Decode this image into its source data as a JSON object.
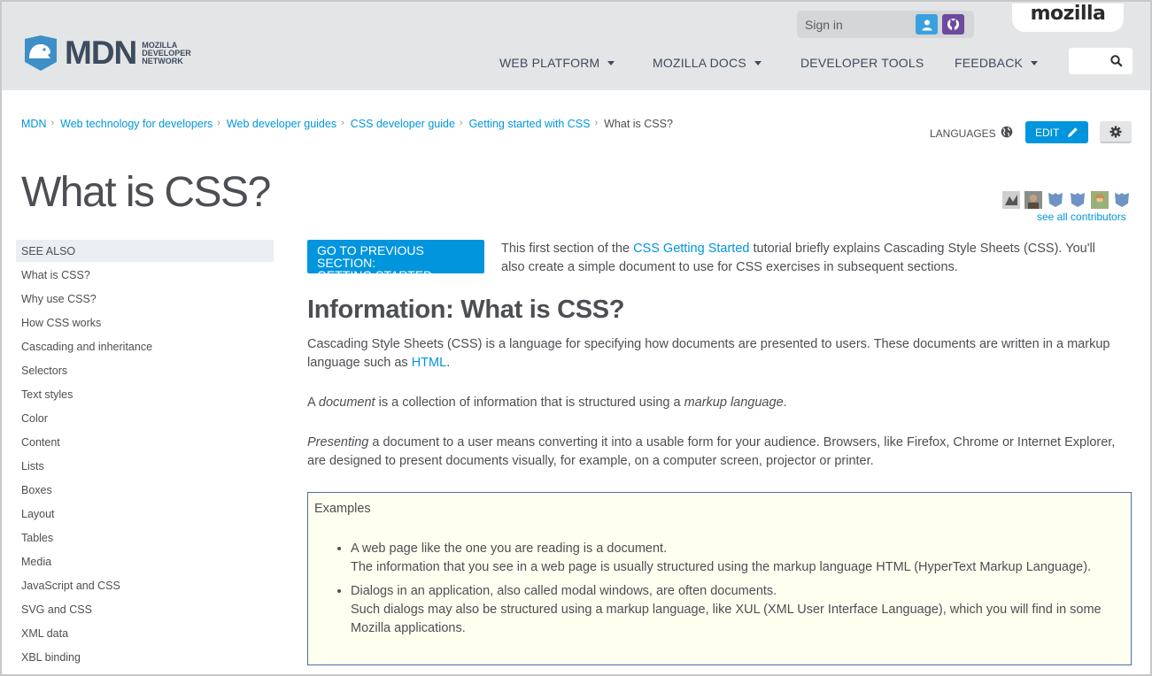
{
  "header": {
    "logo_text": "MDN",
    "logo_sub_lines": [
      "Mozilla",
      "Developer",
      "Network"
    ],
    "signin_label": "Sign in",
    "mozilla_label": "mozilla",
    "nav": [
      {
        "label": "WEB PLATFORM",
        "has_caret": true
      },
      {
        "label": "MOZILLA DOCS",
        "has_caret": true
      },
      {
        "label": "DEVELOPER TOOLS",
        "has_caret": false
      },
      {
        "label": "FEEDBACK",
        "has_caret": true
      }
    ],
    "search_icon": "search-icon"
  },
  "breadcrumbs": {
    "items": [
      "MDN",
      "Web technology for developers",
      "Web developer guides",
      "CSS developer guide",
      "Getting started with CSS"
    ],
    "current": "What is CSS?"
  },
  "toolbar": {
    "languages_label": "LANGUAGES",
    "edit_label": "EDIT"
  },
  "page": {
    "title": "What is CSS?",
    "see_all_contributors": "see all contributors"
  },
  "sidebar": {
    "heading": "SEE ALSO",
    "items": [
      "What is CSS?",
      "Why use CSS?",
      "How CSS works",
      "Cascading and inheritance",
      "Selectors",
      "Text styles",
      "Color",
      "Content",
      "Lists",
      "Boxes",
      "Layout",
      "Tables",
      "Media",
      "JavaScript and CSS",
      "SVG and CSS",
      "XML data",
      "XBL binding"
    ]
  },
  "content": {
    "prev_button_line1": "GO TO PREVIOUS SECTION:",
    "prev_button_line2": "GETTING STARTED",
    "intro_before": "This first section of the ",
    "intro_link": "CSS Getting Started",
    "intro_after": " tutorial briefly explains Cascading Style Sheets (CSS). You'll also create a simple document to use for CSS exercises in subsequent sections.",
    "heading": "Information: What is CSS?",
    "p1_before": "Cascading Style Sheets (CSS) is a language for specifying how documents are presented to users. These documents are written in a markup language such as ",
    "p1_link": "HTML",
    "p1_after": ".",
    "p2_a": "A ",
    "p2_em1": "document",
    "p2_b": " is a collection of information that is structured using a ",
    "p2_em2": "markup language",
    "p2_c": ".",
    "p3_em": "Presenting",
    "p3_rest": " a document to a user means converting it into a usable form for your audience. Browsers, like Firefox, Chrome or Internet Explorer, are designed to present documents visually, for example, on a computer screen, projector or printer.",
    "examples_title": "Examples",
    "example1_line1": "A web page like the one you are reading is a document.",
    "example1_line2": "The information that you see in a web page is usually structured using the markup language HTML (HyperText Markup Language).",
    "example2_line1": "Dialogs in an application, also called modal windows, are often documents.",
    "example2_line2": "Such dialogs may also be structured using a markup language, like XUL (XML User Interface Language), which you will find in some Mozilla applications."
  },
  "colors": {
    "accent": "#0095dd",
    "header_bg": "#e4e5e6",
    "example_bg": "#fffff0"
  }
}
